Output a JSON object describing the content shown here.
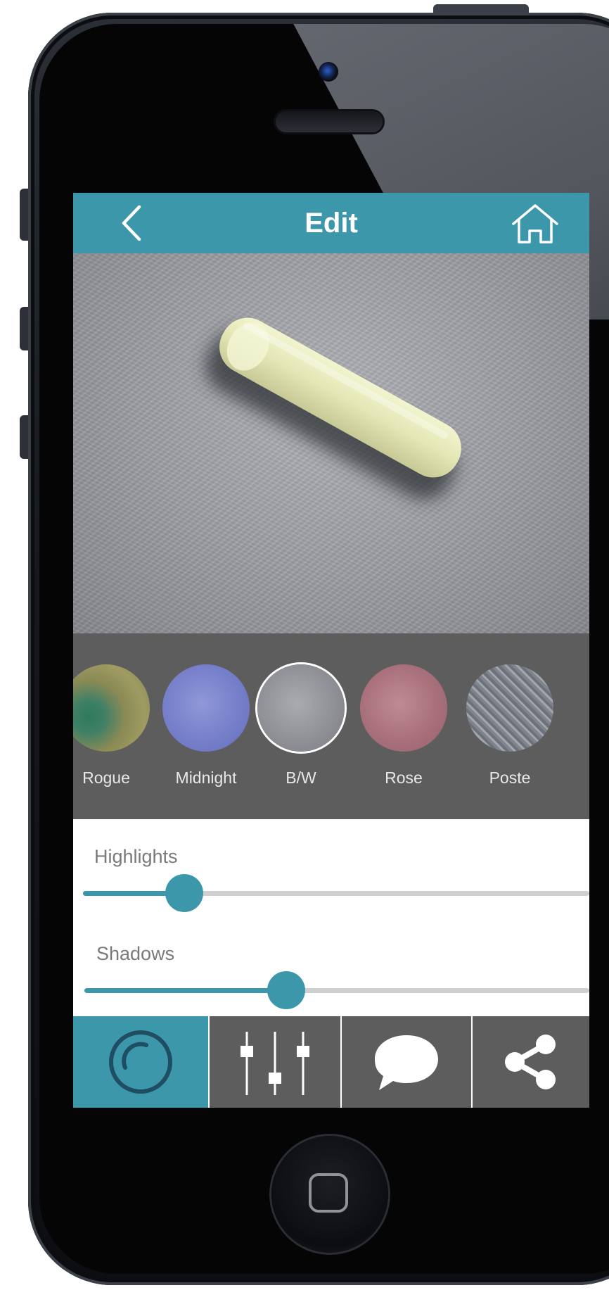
{
  "nav": {
    "title": "Edit",
    "back_icon": "chevron-left-icon",
    "home_icon": "home-icon"
  },
  "filters": [
    {
      "label": "Rogue",
      "selected": false
    },
    {
      "label": "Midnight",
      "selected": false
    },
    {
      "label": "B/W",
      "selected": true
    },
    {
      "label": "Rose",
      "selected": false
    },
    {
      "label": "Poste",
      "selected": false
    }
  ],
  "sliders": {
    "highlights": {
      "label": "Highlights",
      "value": 0.2
    },
    "shadows": {
      "label": "Shadows",
      "value": 0.4
    }
  },
  "tabs": [
    {
      "icon": "filter-circle-icon",
      "active": true
    },
    {
      "icon": "sliders-icon",
      "active": false
    },
    {
      "icon": "speech-bubble-icon",
      "active": false
    },
    {
      "icon": "share-icon",
      "active": false
    }
  ],
  "colors": {
    "accent": "#3d97ab",
    "panel": "#5d5d5d",
    "active_icon": "#1f4e63"
  }
}
